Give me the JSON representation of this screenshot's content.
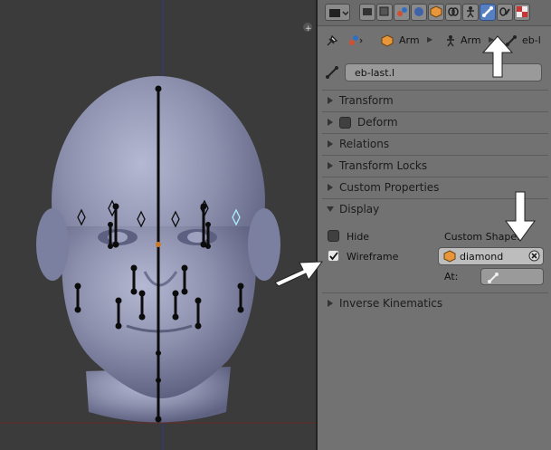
{
  "viewport": {
    "object": "head-model",
    "icon_name": "viewport-add-icon"
  },
  "toolbar": {
    "editor_type_icon": "properties-editor-icon",
    "tabs": [
      "render-icon",
      "render-layers-icon",
      "scene-icon",
      "world-icon",
      "object-icon",
      "constraints-icon",
      "object-data-armature-icon",
      "bone-icon",
      "bone-constraints-icon",
      "texture-icon"
    ],
    "active_tab": "bone-icon"
  },
  "breadcrumb": {
    "items": [
      "Arm",
      "Arm",
      "eb-l"
    ]
  },
  "bone_name": "eb-last.l",
  "sections": {
    "transform": "Transform",
    "deform": "Deform",
    "relations": "Relations",
    "transform_locks": "Transform Locks",
    "custom_properties": "Custom Properties",
    "display": "Display",
    "inverse_kinematics": "Inverse Kinematics"
  },
  "display": {
    "hide_label": "Hide",
    "hide_checked": false,
    "wireframe_label": "Wireframe",
    "wireframe_checked": true,
    "custom_shape_label": "Custom Shape:",
    "custom_shape_value": "diamond",
    "at_label": "At:"
  },
  "colors": {
    "accent_active_tab": "#5680c2",
    "annotation_arrow": "#ffffff",
    "axis_blue": "#2c3a8c",
    "grid_red": "#6b2a2a"
  }
}
